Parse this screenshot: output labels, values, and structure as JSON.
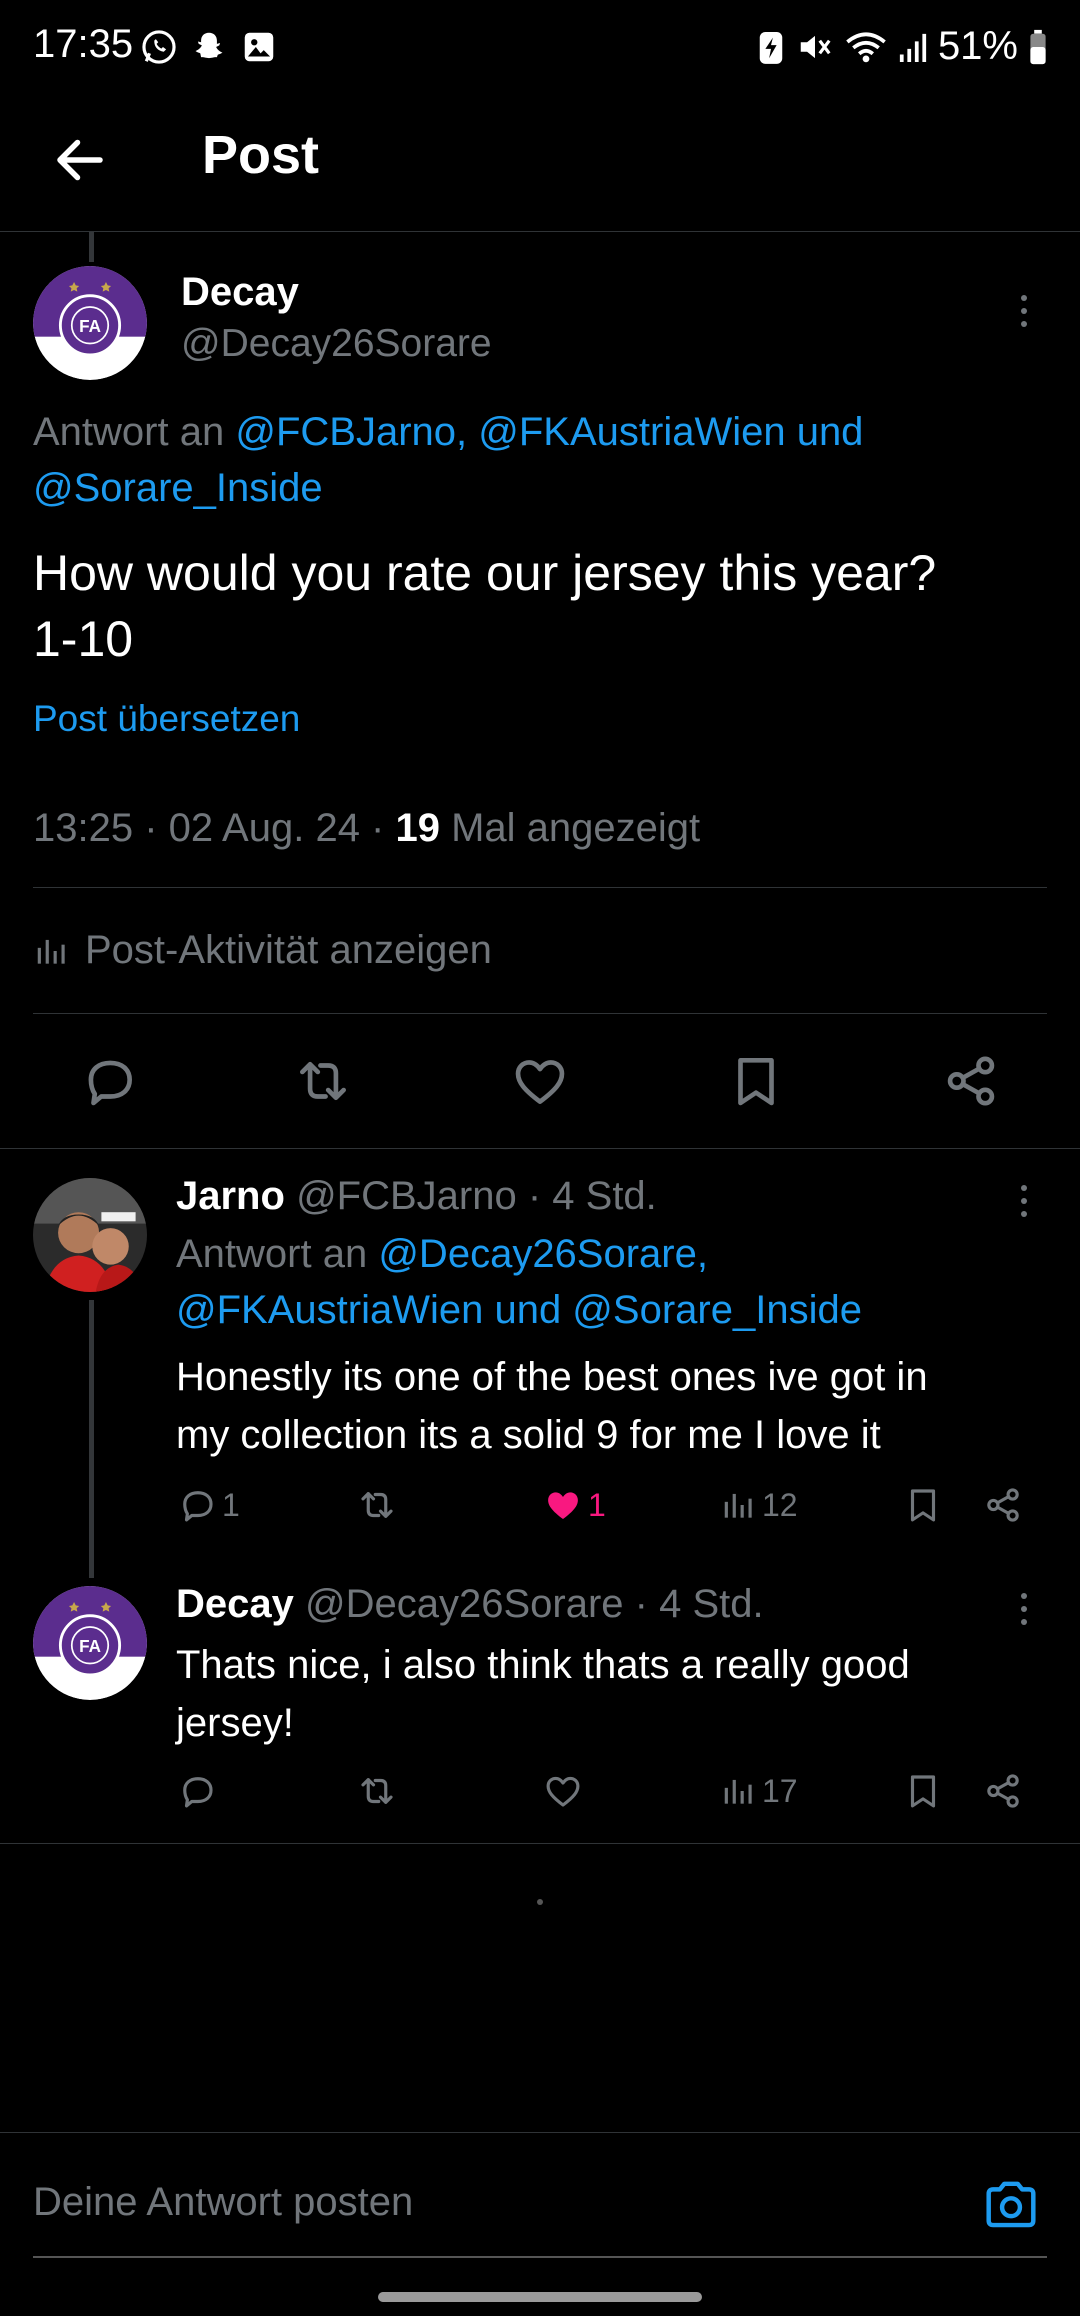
{
  "status_bar": {
    "time": "17:35",
    "battery": "51%"
  },
  "header": {
    "title": "Post"
  },
  "main_post": {
    "author_name": "Decay",
    "author_handle": "@Decay26Sorare",
    "reply_to_prefix": "Antwort an",
    "reply_to_mentions_line1": "@FCBJarno, @FKAustriaWien und",
    "reply_to_mentions_line2": "@Sorare_Inside",
    "text_line1": "How would you rate our jersey this year?",
    "text_line2": "1-10",
    "translate_label": "Post übersetzen",
    "timestamp": "13:25 · 02 Aug. 24 · ",
    "views_count": "19",
    "views_label": " Mal angezeigt",
    "activity_label": "Post-Aktivität anzeigen"
  },
  "replies": [
    {
      "author_name": "Jarno",
      "author_handle": "@FCBJarno · 4 Std.",
      "reply_to_prefix": "Antwort an ",
      "reply_to_mentions_line1": "@Decay26Sorare,",
      "reply_to_mentions_line2": "@FKAustriaWien und @Sorare_Inside",
      "text_line1": "Honestly its one of the best ones ive got in",
      "text_line2": "my collection its a solid 9 for me I love it",
      "reply_count": "1",
      "like_count": "1",
      "view_count": "12",
      "liked": true
    },
    {
      "author_name": "Decay",
      "author_handle": "@Decay26Sorare · 4 Std.",
      "text_line1": "Thats nice, i also think thats a really good",
      "text_line2": "jersey!",
      "view_count": "17",
      "liked": false
    }
  ],
  "composer": {
    "placeholder": "Deine Antwort posten"
  },
  "colors": {
    "accent": "#1d9bf0",
    "like": "#f91880",
    "brand_purple": "#5b2d8e"
  }
}
